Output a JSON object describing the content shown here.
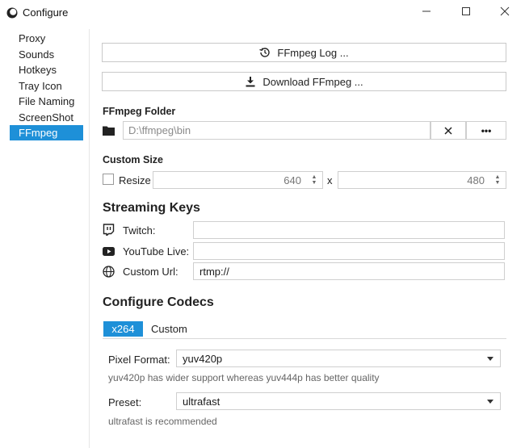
{
  "window": {
    "title": "Configure"
  },
  "sidebar": {
    "items": [
      {
        "label": "Proxy"
      },
      {
        "label": "Sounds"
      },
      {
        "label": "Hotkeys"
      },
      {
        "label": "Tray Icon"
      },
      {
        "label": "File Naming"
      },
      {
        "label": "ScreenShot"
      },
      {
        "label": "FFmpeg",
        "active": true
      }
    ]
  },
  "buttons": {
    "log": "FFmpeg Log ...",
    "download": "Download FFmpeg ..."
  },
  "ffmpeg_folder": {
    "heading": "FFmpeg Folder",
    "path": "D:\\ffmpeg\\bin",
    "browse_label": "•••"
  },
  "custom_size": {
    "heading": "Custom Size",
    "resize_label": "Resize",
    "width": "640",
    "height": "480",
    "separator": "x"
  },
  "streaming": {
    "heading": "Streaming Keys",
    "twitch_label": "Twitch:",
    "twitch_value": "",
    "youtube_label": "YouTube Live:",
    "youtube_value": "",
    "custom_label": "Custom Url:",
    "custom_value": "rtmp://"
  },
  "codecs": {
    "heading": "Configure Codecs",
    "tabs": [
      {
        "label": "x264",
        "active": true
      },
      {
        "label": "Custom"
      }
    ],
    "pixel_format_label": "Pixel Format:",
    "pixel_format_value": "yuv420p",
    "pixel_format_hint": "yuv420p has wider support whereas yuv444p has better quality",
    "preset_label": "Preset:",
    "preset_value": "ultrafast",
    "preset_hint": "ultrafast is recommended"
  },
  "colors": {
    "accent": "#1e90d8"
  }
}
